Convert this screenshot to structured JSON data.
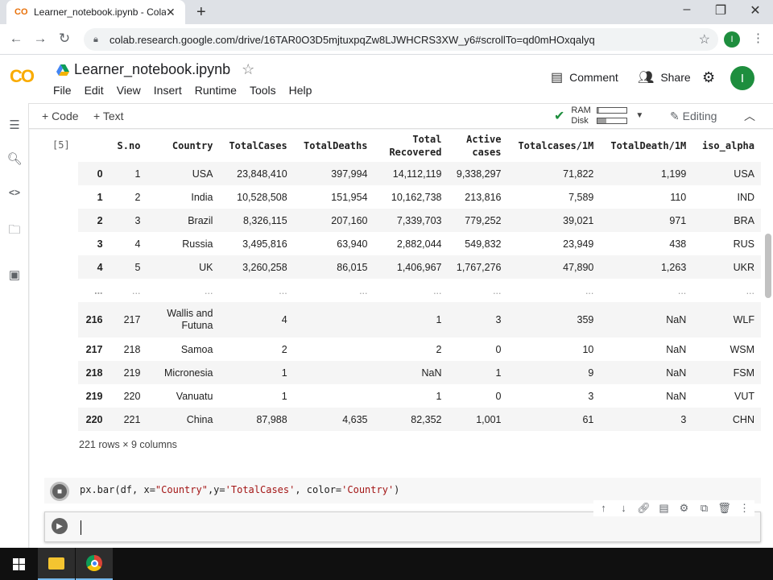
{
  "browser": {
    "tab_title": "Learner_notebook.ipynb - Colab",
    "tab_close": "✕",
    "new_tab": "+",
    "url": "colab.research.google.com/drive/16TAR0O3D5mjtuxpqZw8LJWHCRS3XW_y6#scrollTo=qd0mHOxqalyq",
    "profile_initial": "I",
    "window_minimize": "–",
    "window_restore": "❐",
    "window_close": "✕"
  },
  "colab": {
    "logo": "CO",
    "notebook_title": "Learner_notebook.ipynb",
    "menu": [
      "File",
      "Edit",
      "View",
      "Insert",
      "Runtime",
      "Tools",
      "Help"
    ],
    "comment_label": "Comment",
    "share_label": "Share",
    "avatar_initial": "I"
  },
  "toolbar": {
    "add_code": "+ Code",
    "add_text": "+ Text",
    "ram_label": "RAM",
    "disk_label": "Disk",
    "ram_fraction": 0.05,
    "disk_fraction": 0.3,
    "editing_label": "Editing"
  },
  "output": {
    "exec_count": "[5]",
    "columns": [
      "",
      "S.no",
      "Country",
      "TotalCases",
      "TotalDeaths",
      "Total Recovered",
      "Active cases",
      "Totalcases/1M",
      "TotalDeath/1M",
      "iso_alpha"
    ],
    "rows": [
      [
        "0",
        "1",
        "USA",
        "23,848,410",
        "397,994",
        "14,112,119",
        "9,338,297",
        "71,822",
        "1,199",
        "USA"
      ],
      [
        "1",
        "2",
        "India",
        "10,528,508",
        "151,954",
        "10,162,738",
        "213,816",
        "7,589",
        "110",
        "IND"
      ],
      [
        "2",
        "3",
        "Brazil",
        "8,326,115",
        "207,160",
        "7,339,703",
        "779,252",
        "39,021",
        "971",
        "BRA"
      ],
      [
        "3",
        "4",
        "Russia",
        "3,495,816",
        "63,940",
        "2,882,044",
        "549,832",
        "23,949",
        "438",
        "RUS"
      ],
      [
        "4",
        "5",
        "UK",
        "3,260,258",
        "86,015",
        "1,406,967",
        "1,767,276",
        "47,890",
        "1,263",
        "UKR"
      ],
      [
        "...",
        "...",
        "...",
        "...",
        "...",
        "...",
        "...",
        "...",
        "...",
        "..."
      ],
      [
        "216",
        "217",
        "Wallis and Futuna",
        "4",
        "",
        "1",
        "3",
        "359",
        "NaN",
        "WLF"
      ],
      [
        "217",
        "218",
        "Samoa",
        "2",
        "",
        "2",
        "0",
        "10",
        "NaN",
        "WSM"
      ],
      [
        "218",
        "219",
        "Micronesia",
        "1",
        "",
        "NaN",
        "1",
        "9",
        "NaN",
        "FSM"
      ],
      [
        "219",
        "220",
        "Vanuatu",
        "1",
        "",
        "1",
        "0",
        "3",
        "NaN",
        "VUT"
      ],
      [
        "220",
        "221",
        "China",
        "87,988",
        "4,635",
        "82,352",
        "1,001",
        "61",
        "3",
        "CHN"
      ]
    ],
    "shape_text": "221 rows × 9 columns"
  },
  "code_cell": {
    "p1": "px.bar(df, x=",
    "s1": "\"Country\"",
    "p2": ",y=",
    "s2": "'TotalCases'",
    "p3": ", color=",
    "s3": "'Country'",
    "p4": ")"
  },
  "taskbar": {
    "items": [
      "start",
      "file-explorer",
      "chrome"
    ]
  }
}
